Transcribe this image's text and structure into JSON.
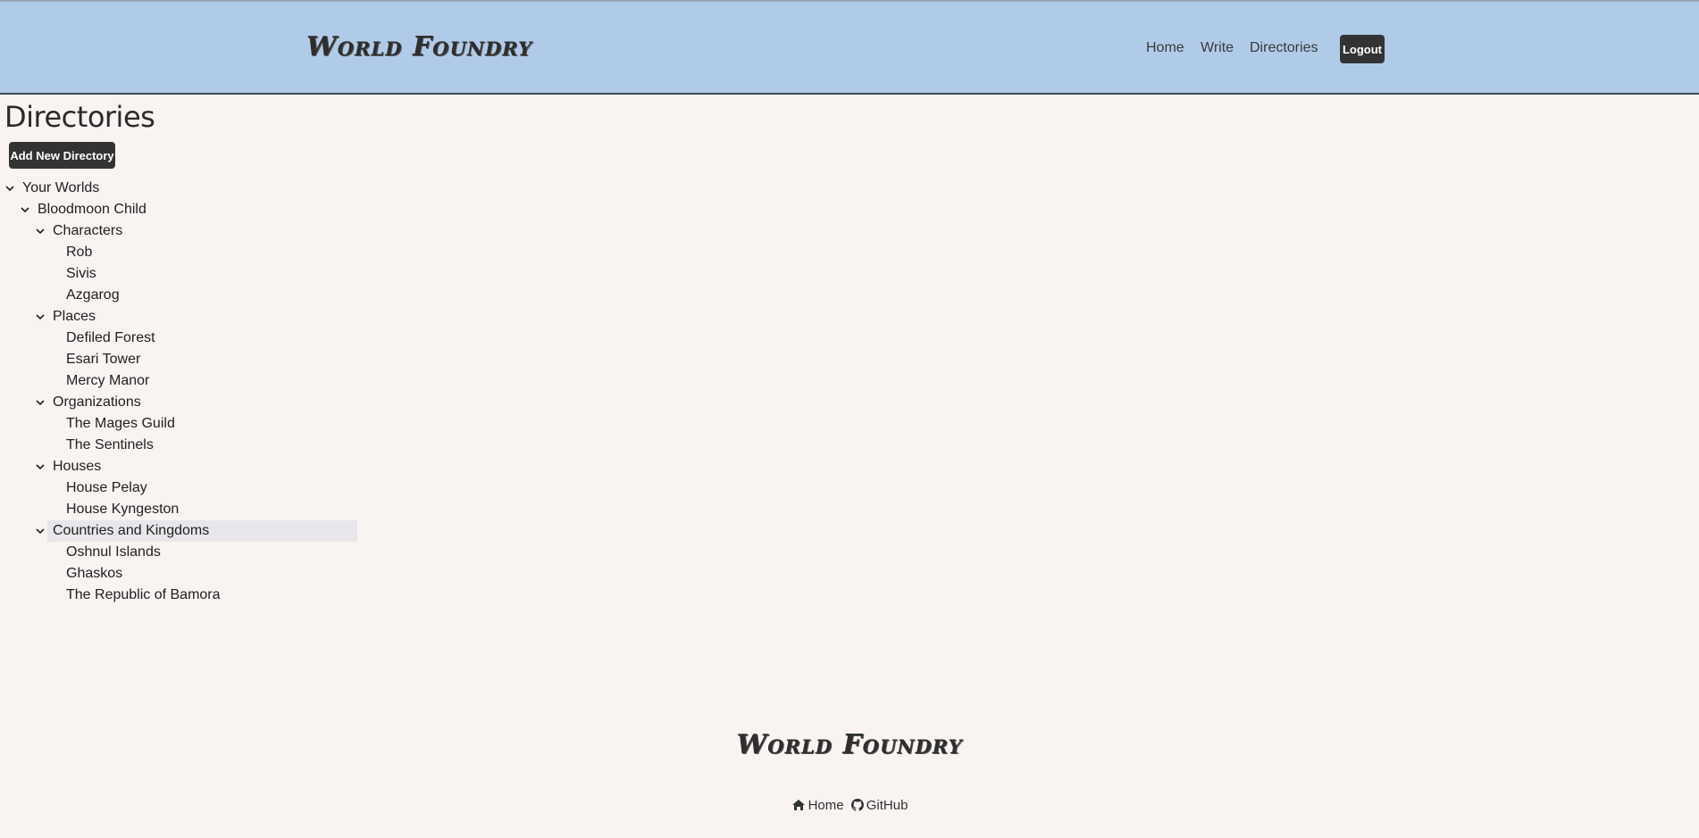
{
  "header": {
    "brand": "World Foundry",
    "nav": {
      "home": "Home",
      "write": "Write",
      "directories": "Directories"
    },
    "logout": "Logout"
  },
  "main": {
    "title": "Directories",
    "add_button": "Add New Directory"
  },
  "tree": {
    "root": "Your Worlds",
    "world": "Bloodmoon Child",
    "groups": [
      {
        "label": "Characters",
        "items": [
          "Rob",
          "Sivis",
          "Azgarog"
        ]
      },
      {
        "label": "Places",
        "items": [
          "Defiled Forest",
          "Esari Tower",
          "Mercy Manor"
        ]
      },
      {
        "label": "Organizations",
        "items": [
          "The Mages Guild",
          "The Sentinels"
        ]
      },
      {
        "label": "Houses",
        "items": [
          "House Pelay",
          "House Kyngeston"
        ]
      },
      {
        "label": "Countries and Kingdoms",
        "items": [
          "Oshnul Islands",
          "Ghaskos",
          "The Republic of Bamora"
        ]
      }
    ],
    "selected": "Countries and Kingdoms"
  },
  "footer": {
    "brand": "World Foundry",
    "links": {
      "home": "Home",
      "github": "GitHub"
    }
  },
  "colors": {
    "header_bg": "#b0cbe8",
    "page_bg": "#f9f4f1",
    "button_bg": "#333333",
    "selected_bg": "#e8e6ea"
  }
}
